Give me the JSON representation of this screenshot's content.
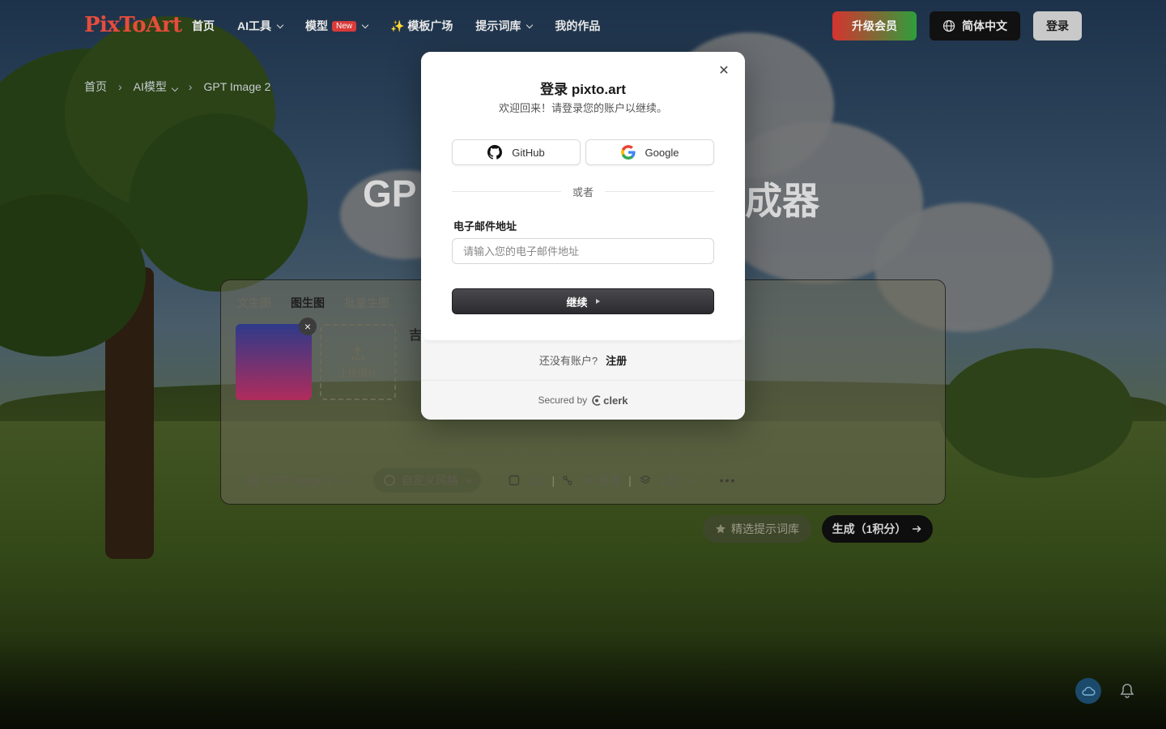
{
  "header": {
    "logo": "PixToArt",
    "nav": [
      {
        "label": "首页"
      },
      {
        "label": "AI工具"
      },
      {
        "label": "模型",
        "badge": "New"
      },
      {
        "label": "✨ 模板广场"
      },
      {
        "label": "提示词库"
      },
      {
        "label": "我的作品"
      }
    ],
    "upgrade": "升级会员",
    "language": "简体中文",
    "login": "登录"
  },
  "breadcrumb": [
    "首页",
    "AI模型",
    "GPT Image 2"
  ],
  "hero": {
    "left": "GP",
    "right": "成器"
  },
  "workspace": {
    "tabs": [
      "文生图",
      "图生图",
      "批量生图"
    ],
    "active_tab": "图生图",
    "upload_label": "上传图片",
    "prompt_text": "吉",
    "model": "GPT Image 2",
    "style": "自定义风格",
    "ratio": "1:1",
    "quality": "1K 标清",
    "count": "1次",
    "featured_prompts": "精选提示词库",
    "generate": "生成（1积分）"
  },
  "modal": {
    "title": "登录 pixto.art",
    "subtitle": "欢迎回来！请登录您的账户以继续。",
    "github": "GitHub",
    "google": "Google",
    "divider": "或者",
    "email_label": "电子邮件地址",
    "email_placeholder": "请输入您的电子邮件地址",
    "email_value": "",
    "continue": "继续",
    "no_account": "还没有账户?",
    "signup": "注册",
    "secured_by": "Secured by",
    "clerk": "clerk"
  },
  "colors": {
    "accent_red": "#e74c3c",
    "new_badge": "#d93a3a",
    "primary_dark": "#2c2c30"
  }
}
